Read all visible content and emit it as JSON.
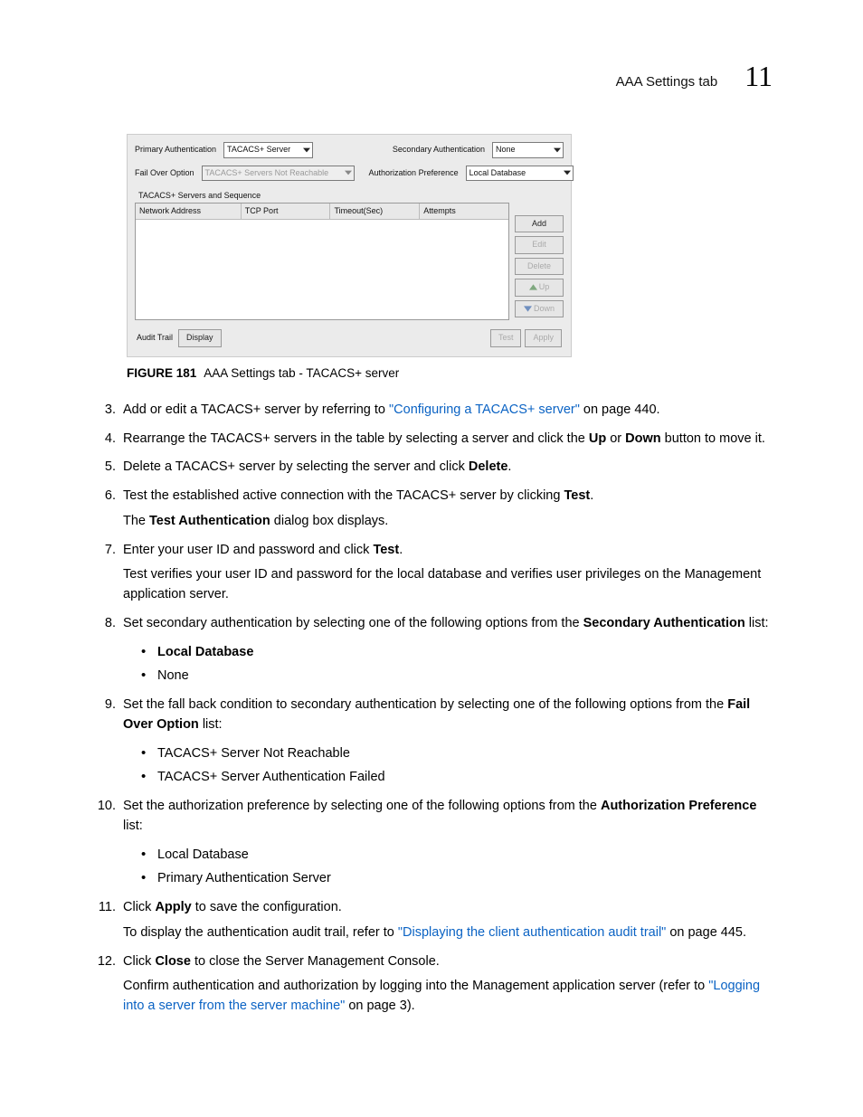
{
  "header": {
    "title": "AAA Settings tab",
    "chapter": "11"
  },
  "shot": {
    "primary_label": "Primary Authentication",
    "primary_value": "TACACS+ Server",
    "secondary_label": "Secondary Authentication",
    "secondary_value": "None",
    "failover_label": "Fail Over Option",
    "failover_value": "TACACS+ Servers Not Reachable",
    "authpref_label": "Authorization Preference",
    "authpref_value": "Local Database",
    "section": "TACACS+ Servers and Sequence",
    "cols": [
      "Network Address",
      "TCP Port",
      "Timeout(Sec)",
      "Attempts"
    ],
    "btns": {
      "add": "Add",
      "edit": "Edit",
      "del": "Delete",
      "up": "Up",
      "down": "Down"
    },
    "footer": {
      "audit": "Audit Trail",
      "display": "Display",
      "test": "Test",
      "apply": "Apply"
    }
  },
  "fig": {
    "label": "FIGURE 181",
    "caption": "AAA Settings tab - TACACS+ server"
  },
  "s3": {
    "t1": "Add or edit a TACACS+ server by referring to ",
    "link": "\"Configuring a TACACS+ server\"",
    "t2": " on page 440."
  },
  "s4": {
    "t1": "Rearrange the TACACS+ servers in the table by selecting a server and click the ",
    "b1": "Up",
    "t2": " or ",
    "b2": "Down",
    "t3": " button to move it."
  },
  "s5": {
    "t1": "Delete a TACACS+ server by selecting the server and click ",
    "b1": "Delete",
    "t2": "."
  },
  "s6": {
    "t1": "Test the established active connection with the TACACS+ server by clicking ",
    "b1": "Test",
    "t2": ".",
    "sub1a": "The ",
    "sub1b": "Test Authentication",
    "sub1c": " dialog box displays."
  },
  "s7": {
    "t1": "Enter your user ID and password and click ",
    "b1": "Test",
    "t2": ".",
    "sub": "Test verifies your user ID and password for the local database and verifies user privileges on the Management application server."
  },
  "s8": {
    "t1": "Set secondary authentication by selecting one of the following options from the ",
    "b1": "Secondary Authentication",
    "t2": " list:",
    "bul1": "Local Database",
    "bul2": "None"
  },
  "s9": {
    "t1": "Set the fall back condition to secondary authentication by selecting one of the following options from the ",
    "b1": "Fail Over Option",
    "t2": " list:",
    "bul1": "TACACS+ Server Not Reachable",
    "bul2": "TACACS+ Server Authentication Failed"
  },
  "s10": {
    "t1": "Set the authorization preference by selecting one of the following options from the ",
    "b1": "Authorization Preference",
    "t2": " list:",
    "bul1": "Local Database",
    "bul2": "Primary Authentication Server"
  },
  "s11": {
    "t1": "Click ",
    "b1": "Apply",
    "t2": " to save the configuration.",
    "sub1": "To display the authentication audit trail, refer to ",
    "link": "\"Displaying the client authentication audit trail\"",
    "sub2": " on page 445."
  },
  "s12": {
    "t1": "Click ",
    "b1": "Close",
    "t2": " to close the Server Management Console.",
    "sub1": "Confirm authentication and authorization by logging into the Management application server (refer to ",
    "link": "\"Logging into a server from the server machine\"",
    "sub2": " on page 3)."
  }
}
